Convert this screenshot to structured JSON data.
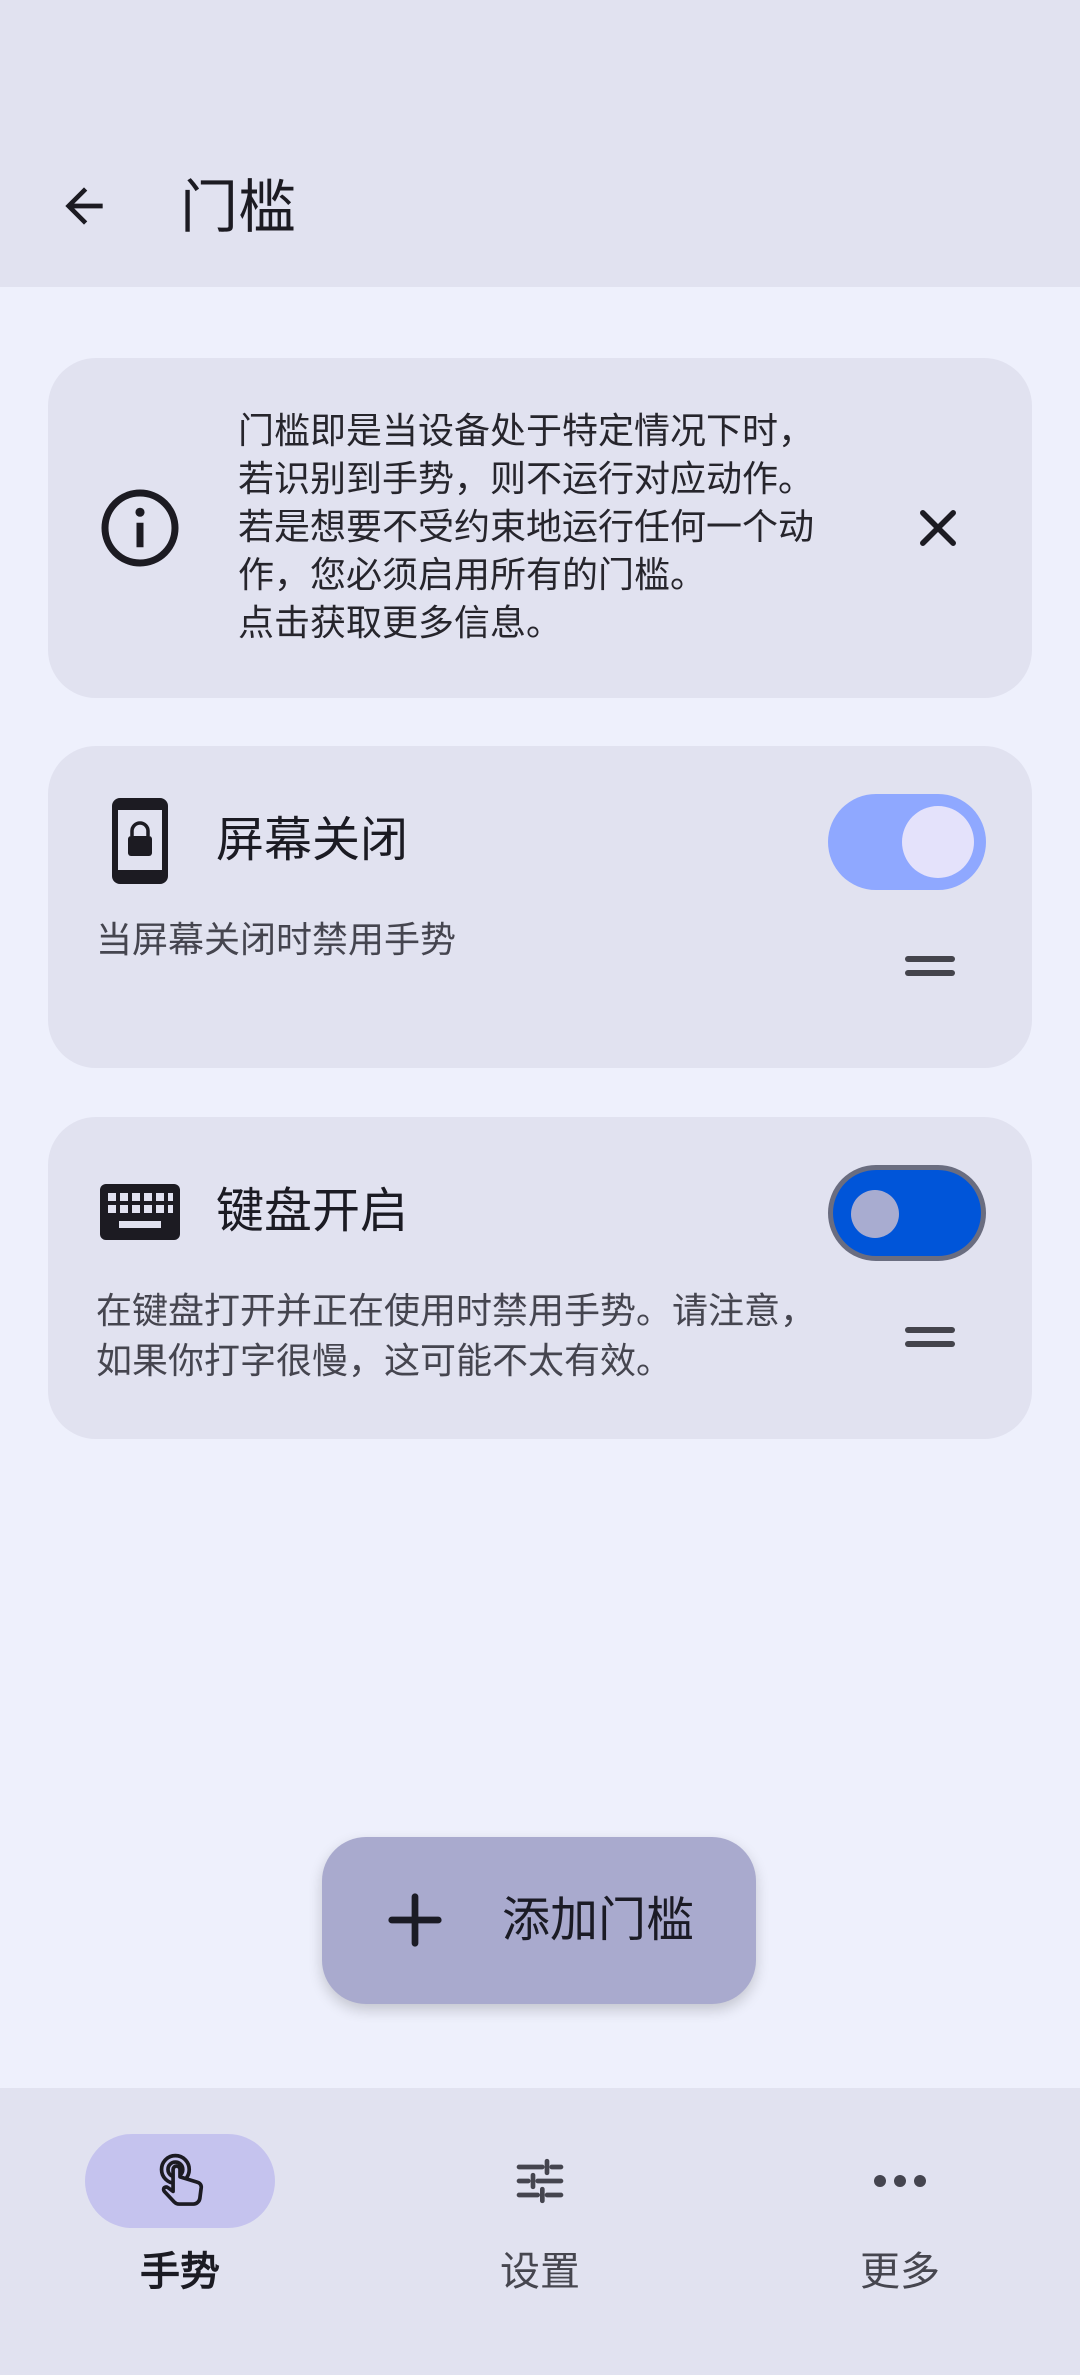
{
  "appbar": {
    "title": "门槛",
    "back_icon": "arrow-left-icon"
  },
  "info_card": {
    "icon": "info-icon",
    "lines": [
      "门槛即是当设备处于特定情况下时，",
      "若识别到手势，则不运行对应动作。",
      "若是想要不受约束地运行任何一个动",
      "作，您必须启用所有的门槛。",
      "点击获取更多信息。"
    ],
    "close_icon": "close-icon"
  },
  "thresholds": [
    {
      "icon": "phone-lock-icon",
      "title": "屏幕关闭",
      "description_lines": [
        "当屏幕关闭时禁用手势"
      ],
      "enabled": true
    },
    {
      "icon": "keyboard-icon",
      "title": "键盘开启",
      "description_lines": [
        "在键盘打开并正在使用时禁用手势。请注意，",
        "如果你打字很慢，这可能不太有效。"
      ],
      "enabled": true
    }
  ],
  "fab": {
    "icon": "plus-icon",
    "label": "添加门槛"
  },
  "bottom_nav": [
    {
      "icon": "gesture-touch-icon",
      "label": "手势",
      "selected": true
    },
    {
      "icon": "tune-sliders-icon",
      "label": "设置",
      "selected": false
    },
    {
      "icon": "more-horizontal-icon",
      "label": "更多",
      "selected": false
    }
  ],
  "colors": {
    "background": "#eef0fc",
    "surface": "#e1e2f0",
    "toggle_light": "#8fa8ff",
    "toggle_dark": "#0055d9",
    "fab": "#a9aace",
    "nav_selected_pill": "#c5c3ee"
  }
}
